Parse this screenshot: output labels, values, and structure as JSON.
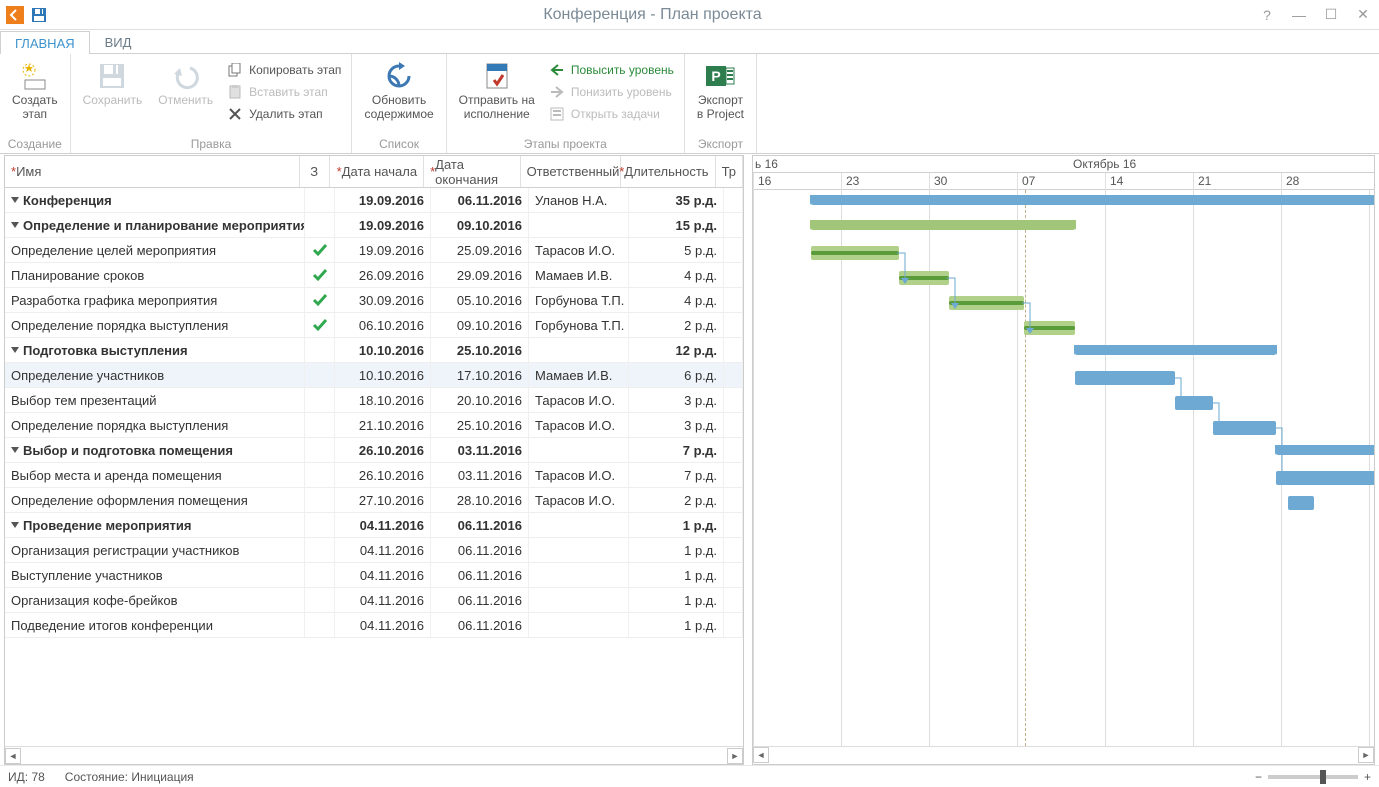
{
  "title": "Конференция - План проекта",
  "tabs": {
    "main": "ГЛАВНАЯ",
    "view": "ВИД"
  },
  "ribbon": {
    "create": {
      "btn": "Создать\nэтап",
      "group": "Создание"
    },
    "save": "Сохранить",
    "undo": "Отменить",
    "edit": {
      "copy": "Копировать этап",
      "paste": "Вставить этап",
      "del": "Удалить этап",
      "group": "Правка"
    },
    "refresh": {
      "btn": "Обновить\nсодержимое",
      "group": "Список"
    },
    "stages": {
      "send": "Отправить на\nисполнение",
      "up": "Повысить уровень",
      "down": "Понизить уровень",
      "open": "Открыть задачи",
      "group": "Этапы проекта"
    },
    "export": {
      "btn": "Экспорт\nв Project",
      "group": "Экспорт"
    }
  },
  "grid": {
    "columns": {
      "name": "Имя",
      "stat": "З",
      "start": "Дата начала",
      "end": "Дата окончания",
      "resp": "Ответственный",
      "dur": "Длительность",
      "extra": "Тр"
    },
    "rows": [
      {
        "name": "Конференция",
        "level": 0,
        "bold": true,
        "exp": true,
        "start": "19.09.2016",
        "end": "06.11.2016",
        "resp": "Уланов Н.А.",
        "dur": "35 р.д."
      },
      {
        "name": "Определение и планирование мероприятия",
        "level": 1,
        "bold": true,
        "exp": true,
        "start": "19.09.2016",
        "end": "09.10.2016",
        "resp": "",
        "dur": "15 р.д."
      },
      {
        "name": "Определение целей мероприятия",
        "level": 2,
        "done": true,
        "start": "19.09.2016",
        "end": "25.09.2016",
        "resp": "Тарасов И.О.",
        "dur": "5 р.д."
      },
      {
        "name": "Планирование сроков",
        "level": 2,
        "done": true,
        "start": "26.09.2016",
        "end": "29.09.2016",
        "resp": "Мамаев И.В.",
        "dur": "4 р.д."
      },
      {
        "name": "Разработка графика мероприятия",
        "level": 2,
        "done": true,
        "start": "30.09.2016",
        "end": "05.10.2016",
        "resp": "Горбунова Т.П.",
        "dur": "4 р.д."
      },
      {
        "name": "Определение порядка выступления",
        "level": 2,
        "done": true,
        "start": "06.10.2016",
        "end": "09.10.2016",
        "resp": "Горбунова Т.П.",
        "dur": "2 р.д."
      },
      {
        "name": "Подготовка выступления",
        "level": 1,
        "bold": true,
        "exp": true,
        "start": "10.10.2016",
        "end": "25.10.2016",
        "resp": "",
        "dur": "12 р.д."
      },
      {
        "name": "Определение участников",
        "level": 2,
        "hover": true,
        "start": "10.10.2016",
        "end": "17.10.2016",
        "resp": "Мамаев И.В.",
        "dur": "6 р.д."
      },
      {
        "name": "Выбор тем презентаций",
        "level": 2,
        "start": "18.10.2016",
        "end": "20.10.2016",
        "resp": "Тарасов И.О.",
        "dur": "3 р.д."
      },
      {
        "name": "Определение порядка выступления",
        "level": 2,
        "start": "21.10.2016",
        "end": "25.10.2016",
        "resp": "Тарасов И.О.",
        "dur": "3 р.д."
      },
      {
        "name": "Выбор и подготовка помещения",
        "level": 1,
        "bold": true,
        "exp": true,
        "start": "26.10.2016",
        "end": "03.11.2016",
        "resp": "",
        "dur": "7 р.д."
      },
      {
        "name": "Выбор места и аренда помещения",
        "level": 2,
        "start": "26.10.2016",
        "end": "03.11.2016",
        "resp": "Тарасов И.О.",
        "dur": "7 р.д."
      },
      {
        "name": "Определение оформления помещения",
        "level": 2,
        "start": "27.10.2016",
        "end": "28.10.2016",
        "resp": "Тарасов И.О.",
        "dur": "2 р.д."
      },
      {
        "name": "Проведение мероприятия",
        "level": 1,
        "bold": true,
        "exp": true,
        "start": "04.11.2016",
        "end": "06.11.2016",
        "resp": "",
        "dur": "1 р.д."
      },
      {
        "name": "Организация регистрации участников",
        "level": 2,
        "start": "04.11.2016",
        "end": "06.11.2016",
        "resp": "",
        "dur": "1 р.д."
      },
      {
        "name": "Выступление участников",
        "level": 2,
        "start": "04.11.2016",
        "end": "06.11.2016",
        "resp": "",
        "dur": "1 р.д."
      },
      {
        "name": "Организация кофе-брейков",
        "level": 2,
        "start": "04.11.2016",
        "end": "06.11.2016",
        "resp": "",
        "dur": "1 р.д."
      },
      {
        "name": "Подведение итогов конференции",
        "level": 2,
        "start": "04.11.2016",
        "end": "06.11.2016",
        "resp": "",
        "dur": "1 р.д."
      }
    ]
  },
  "gantt": {
    "month_left": "ь 16",
    "month_main": "Октябрь 16",
    "weeks": [
      "16",
      "23",
      "30",
      "07",
      "14",
      "21",
      "28"
    ]
  },
  "status": {
    "id_label": "ИД:",
    "id_val": "78",
    "state_label": "Состояние:",
    "state_val": "Инициация"
  }
}
